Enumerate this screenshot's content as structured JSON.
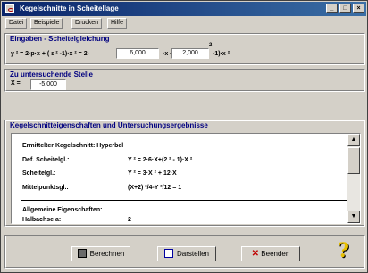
{
  "window": {
    "title": "Kegelschnitte in Scheitellage",
    "app_icon": "conic-app-icon"
  },
  "menu": [
    "Datei",
    "Beispiele",
    "Drucken",
    "Hilfe"
  ],
  "input_group": {
    "label": "Eingaben - Scheitelgleichung",
    "formula_a": "y ² = 2·p·x + ( ε ² -1)·x ² = 2·",
    "formula_b": "·x + (",
    "formula_c": "-1)·x ²",
    "sup": "2",
    "p_value": "6,000",
    "eps_value": "2,000"
  },
  "point_group": {
    "label": "Zu untersuchende Stelle",
    "x_label": "X =",
    "x_value": "-5,000"
  },
  "result_group": {
    "label": "Kegelschnitteigenschaften und Untersuchungsergebnisse",
    "line1": "Ermittelter Kegelschnitt: Hyperbel",
    "rows": [
      {
        "label": "Def. Scheitelgl.:",
        "value": "Y ² = 2·6·X+(2 ² - 1)·X ²"
      },
      {
        "label": "Scheitelgl.:",
        "value": "Y ² = 3·X ² + 12·X"
      },
      {
        "label": "Mittelpunktsgl.:",
        "value": "(X+2) ²/4-Y ²/12 = 1"
      }
    ],
    "general_heading": "Allgemeine Eigenschaften:",
    "halbachse_label": "Halbachse a:",
    "halbachse_value": "2"
  },
  "buttons": {
    "berechnen": "Berechnen",
    "darstellen": "Darstellen",
    "beenden": "Beenden"
  },
  "icons": {
    "calculate": "calculator-icon",
    "plot": "plot-icon",
    "close": "close-icon",
    "help": "help-icon"
  }
}
